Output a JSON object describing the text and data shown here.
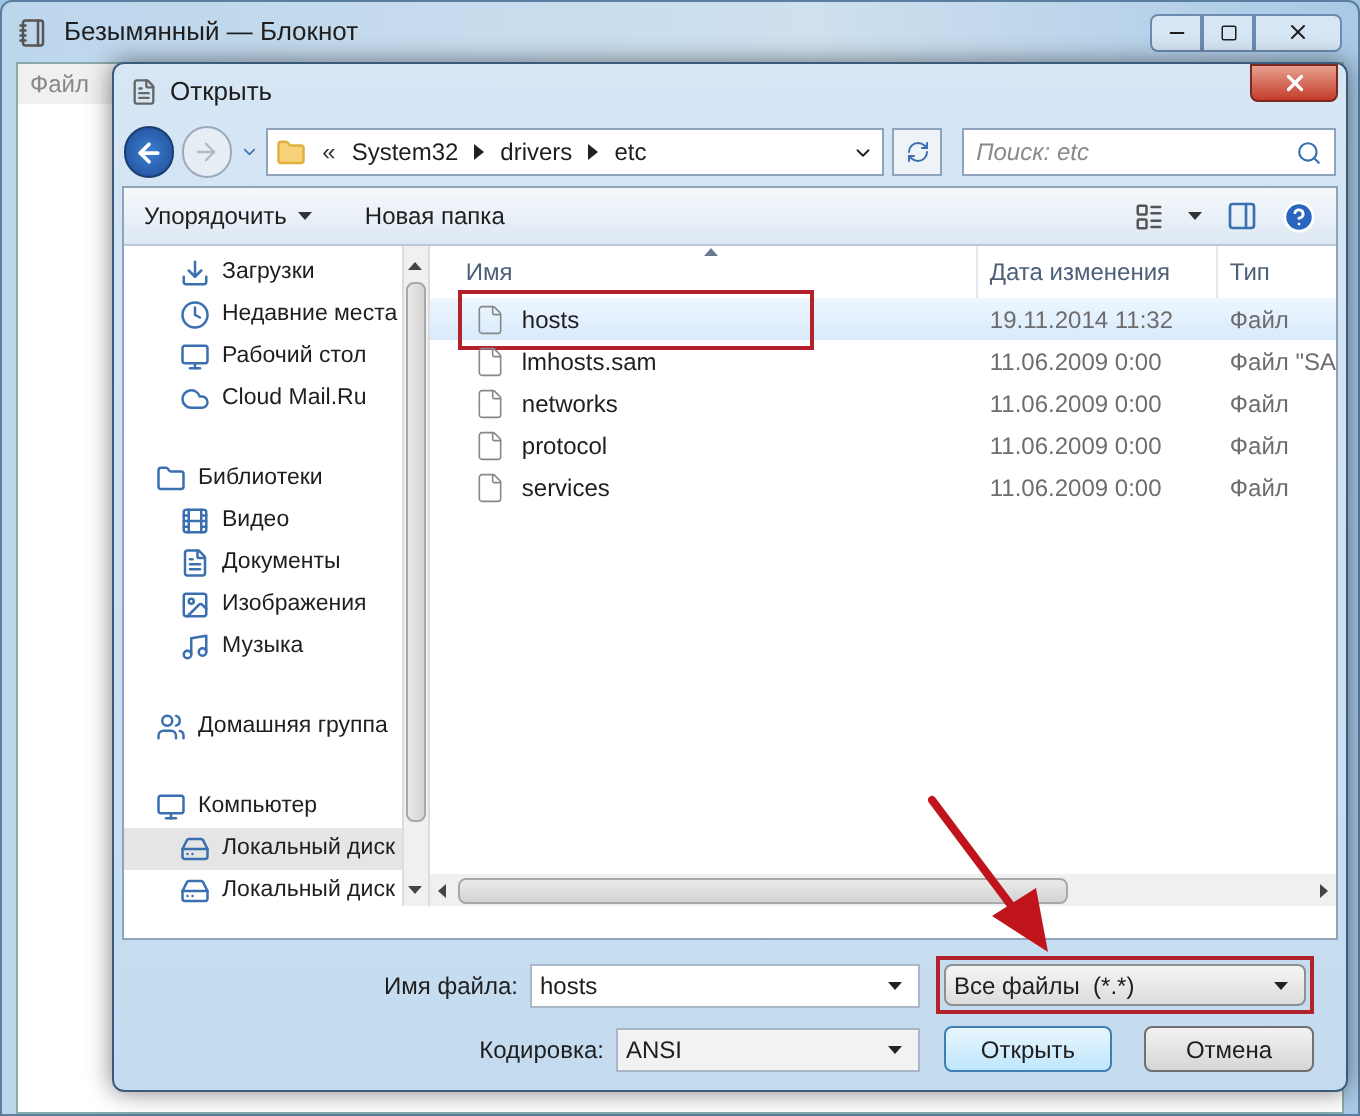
{
  "notepad": {
    "title": "Безымянный — Блокнот",
    "menu": [
      "Файл"
    ]
  },
  "dialog": {
    "title": "Открыть",
    "path_overflow": "«",
    "path": [
      "System32",
      "drivers",
      "etc"
    ],
    "search": {
      "placeholder": "Поиск: etc"
    },
    "toolbar": [
      "Упорядочить",
      "Новая папка"
    ],
    "sidebar": [
      {
        "children": [
          {
            "label": "Загрузки",
            "kind": "downloads",
            "selected": false
          },
          {
            "label": "Недавние места",
            "kind": "recent",
            "selected": false
          },
          {
            "label": "Рабочий стол",
            "kind": "desktop",
            "selected": false
          },
          {
            "label": "Cloud Mail.Ru",
            "kind": "cloud",
            "selected": false
          }
        ]
      },
      {
        "label": "Библиотеки",
        "kind": "library",
        "selected": false,
        "children": [
          {
            "label": "Видео",
            "kind": "video",
            "selected": false
          },
          {
            "label": "Документы",
            "kind": "documents",
            "selected": false
          },
          {
            "label": "Изображения",
            "kind": "images",
            "selected": false
          },
          {
            "label": "Музыка",
            "kind": "music",
            "selected": false
          }
        ]
      },
      {
        "label": "Домашняя группа",
        "kind": "homegroup",
        "selected": false
      },
      {
        "label": "Компьютер",
        "kind": "computer",
        "selected": false,
        "children": [
          {
            "label": "Локальный диск",
            "kind": "disk",
            "selected": true
          },
          {
            "label": "Локальный диск",
            "kind": "disk",
            "selected": false
          }
        ]
      }
    ],
    "columns": [
      "Имя",
      "Дата изменения",
      "Тип"
    ],
    "files": [
      {
        "name": "hosts",
        "date": "19.11.2014 11:32",
        "type": "Файл",
        "selected": true,
        "outlined": true
      },
      {
        "name": "lmhosts.sam",
        "date": "11.06.2009 0:00",
        "type": "Файл \"SA",
        "selected": false,
        "outlined": false
      },
      {
        "name": "networks",
        "date": "11.06.2009 0:00",
        "type": "Файл",
        "selected": false,
        "outlined": false
      },
      {
        "name": "protocol",
        "date": "11.06.2009 0:00",
        "type": "Файл",
        "selected": false,
        "outlined": false
      },
      {
        "name": "services",
        "date": "11.06.2009 0:00",
        "type": "Файл",
        "selected": false,
        "outlined": false
      }
    ],
    "filename": {
      "label": "Имя файла:",
      "value": "hosts"
    },
    "filter": {
      "value": "Все файлы  (*.*)",
      "outlined": true
    },
    "encoding": {
      "label": "Кодировка:",
      "value": "ANSI"
    },
    "buttons": [
      "Открыть",
      "Отмена"
    ]
  }
}
